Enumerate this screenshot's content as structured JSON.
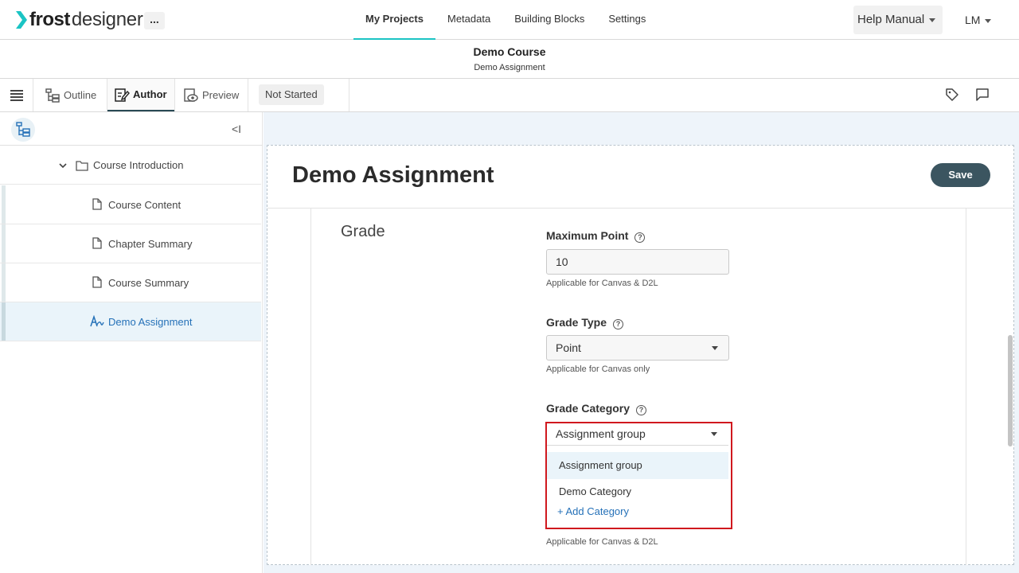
{
  "app": {
    "logo_bold": "frost",
    "logo_light": "designer",
    "more_label": "...",
    "brand_color": "#1bc4c4"
  },
  "nav": {
    "items": [
      {
        "label": "My Projects",
        "active": true
      },
      {
        "label": "Metadata"
      },
      {
        "label": "Building Blocks"
      },
      {
        "label": "Settings"
      }
    ],
    "help_label": "Help Manual",
    "user_initials": "LM"
  },
  "course": {
    "title": "Demo Course",
    "subtitle": "Demo Assignment"
  },
  "toolbar": {
    "outline": "Outline",
    "author": "Author",
    "preview": "Preview",
    "status": "Not Started"
  },
  "sidebar": {
    "collapse_label": "<I",
    "items": [
      {
        "label": "Course Introduction",
        "type": "folder"
      },
      {
        "label": "Course Content",
        "type": "page"
      },
      {
        "label": "Chapter Summary",
        "type": "page"
      },
      {
        "label": "Course Summary",
        "type": "page"
      },
      {
        "label": "Demo Assignment",
        "type": "assignment",
        "selected": true
      }
    ]
  },
  "editor": {
    "title": "Demo Assignment",
    "save_label": "Save",
    "section_title": "Grade",
    "max_point": {
      "label": "Maximum Point",
      "value": "10",
      "hint": "Applicable for Canvas & D2L"
    },
    "grade_type": {
      "label": "Grade Type",
      "value": "Point",
      "hint": "Applicable for Canvas only"
    },
    "grade_category": {
      "label": "Grade Category",
      "value": "Assignment group",
      "options": [
        "Assignment group",
        "Demo Category"
      ],
      "add_label": "Add Category",
      "hint": "Applicable for Canvas & D2L"
    }
  },
  "colors": {
    "save_button": "#3b5560",
    "highlight_outline": "#d0181e",
    "link_blue": "#2571b8"
  }
}
